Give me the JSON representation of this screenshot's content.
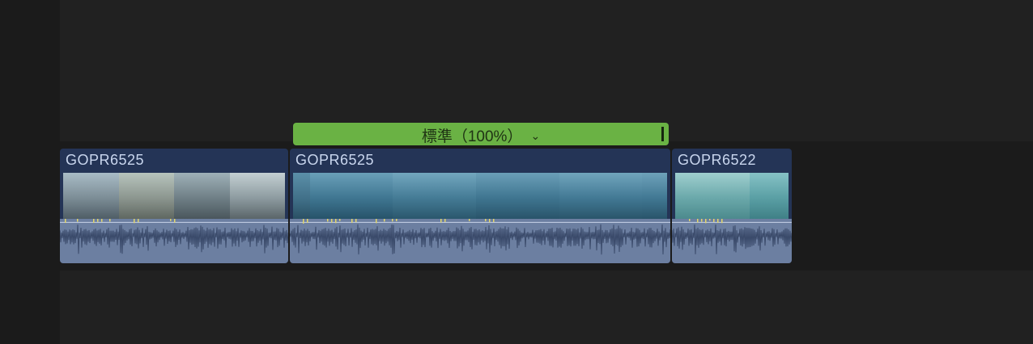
{
  "timeline": {
    "clips": [
      {
        "name": "GOPR6525"
      },
      {
        "name": "GOPR6525"
      },
      {
        "name": "GOPR6522"
      }
    ],
    "speed_bar": {
      "label": "標準（100%）",
      "chevron_icon": "chevron-down-icon"
    }
  },
  "colors": {
    "background": "#212121",
    "storyline": "#1b1b1b",
    "clip_header": "#243456",
    "waveform": "#6c7fa1",
    "speed_bar": "#6ab244"
  }
}
